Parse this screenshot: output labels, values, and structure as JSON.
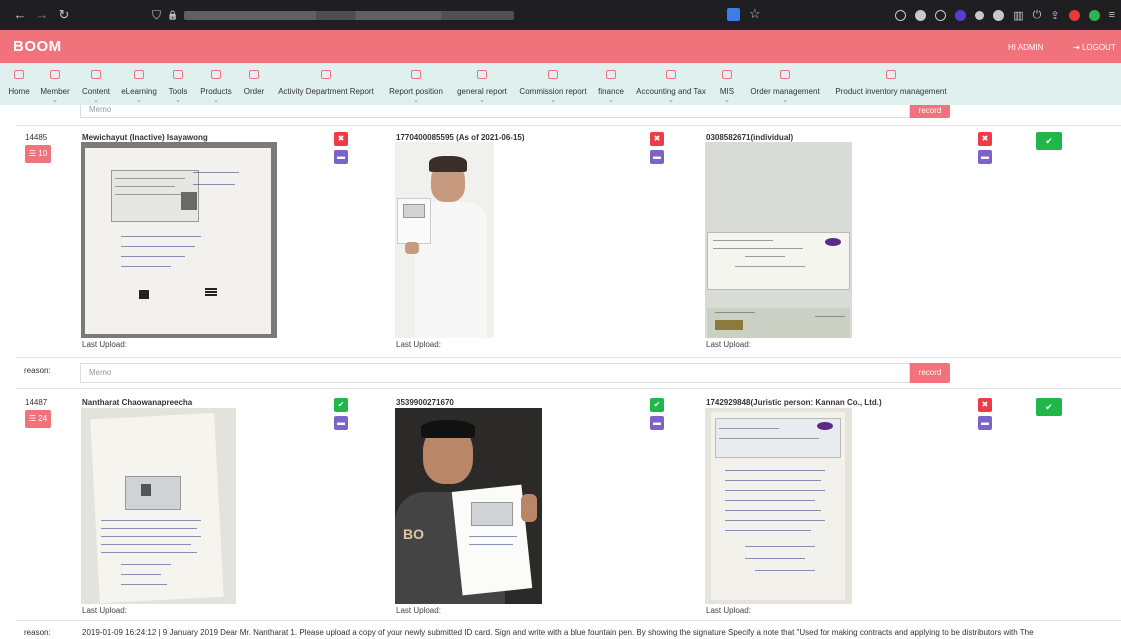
{
  "browser": {
    "back_icon": "←",
    "forward_icon": "→",
    "reload_icon": "↻",
    "shield_icon": "⛉",
    "lock_icon": "🔒",
    "star_icon": "☆"
  },
  "header": {
    "logo": "BOOM",
    "greeting": "HI ADMIN",
    "logout_label": "LOGOUT"
  },
  "menu": {
    "items": [
      {
        "label": "Home"
      },
      {
        "label": "Member"
      },
      {
        "label": "Content"
      },
      {
        "label": "eLearning"
      },
      {
        "label": "Tools"
      },
      {
        "label": "Products"
      },
      {
        "label": "Order"
      },
      {
        "label": "Activity Department Report"
      },
      {
        "label": "Report position"
      },
      {
        "label": "general report"
      },
      {
        "label": "Commission report"
      },
      {
        "label": "finance"
      },
      {
        "label": "Accounting and Tax"
      },
      {
        "label": "MIS"
      },
      {
        "label": "Order management"
      },
      {
        "label": "Product inventory management"
      }
    ]
  },
  "top_memo": {
    "placeholder": "Memo",
    "record_label": "record"
  },
  "records": [
    {
      "id": "14485",
      "count": "10",
      "name": "Mewichayut (Inactive) Isayawong",
      "doc_title_2": "1770400085595 (As of 2021-06-15)",
      "doc_title_3": "0308582671(individual)",
      "last_upload_1": "Last Upload:",
      "last_upload_2": "Last Upload:",
      "last_upload_3": "Last Upload:",
      "reason_label": "reason:",
      "memo_placeholder": "Memo",
      "record_label": "record"
    },
    {
      "id": "14487",
      "count": "24",
      "name": "Nantharat Chaowanapreecha",
      "doc_title_2": "3539900271670",
      "doc_title_3": "1742929848(Juristic person: Kannan Co., Ltd.)",
      "last_upload_1": "Last Upload:",
      "last_upload_2": "Last Upload:",
      "last_upload_3": "Last Upload:",
      "reason_label": "reason:",
      "reason_text": "2019-01-09 16:24:12 | 9 January 2019 Dear Mr. Nantharat 1. Please upload a copy of your newly submitted ID card. Sign and write with a blue fountain pen. By showing the signature Specify a note that \"Used for making contracts and applying to be distributors with The"
    }
  ],
  "colors": {
    "brand": "#f0727b",
    "menu_bg": "#dff0ee",
    "reject": "#ef3b46",
    "edit": "#7b63c9",
    "approve": "#21b64a"
  }
}
